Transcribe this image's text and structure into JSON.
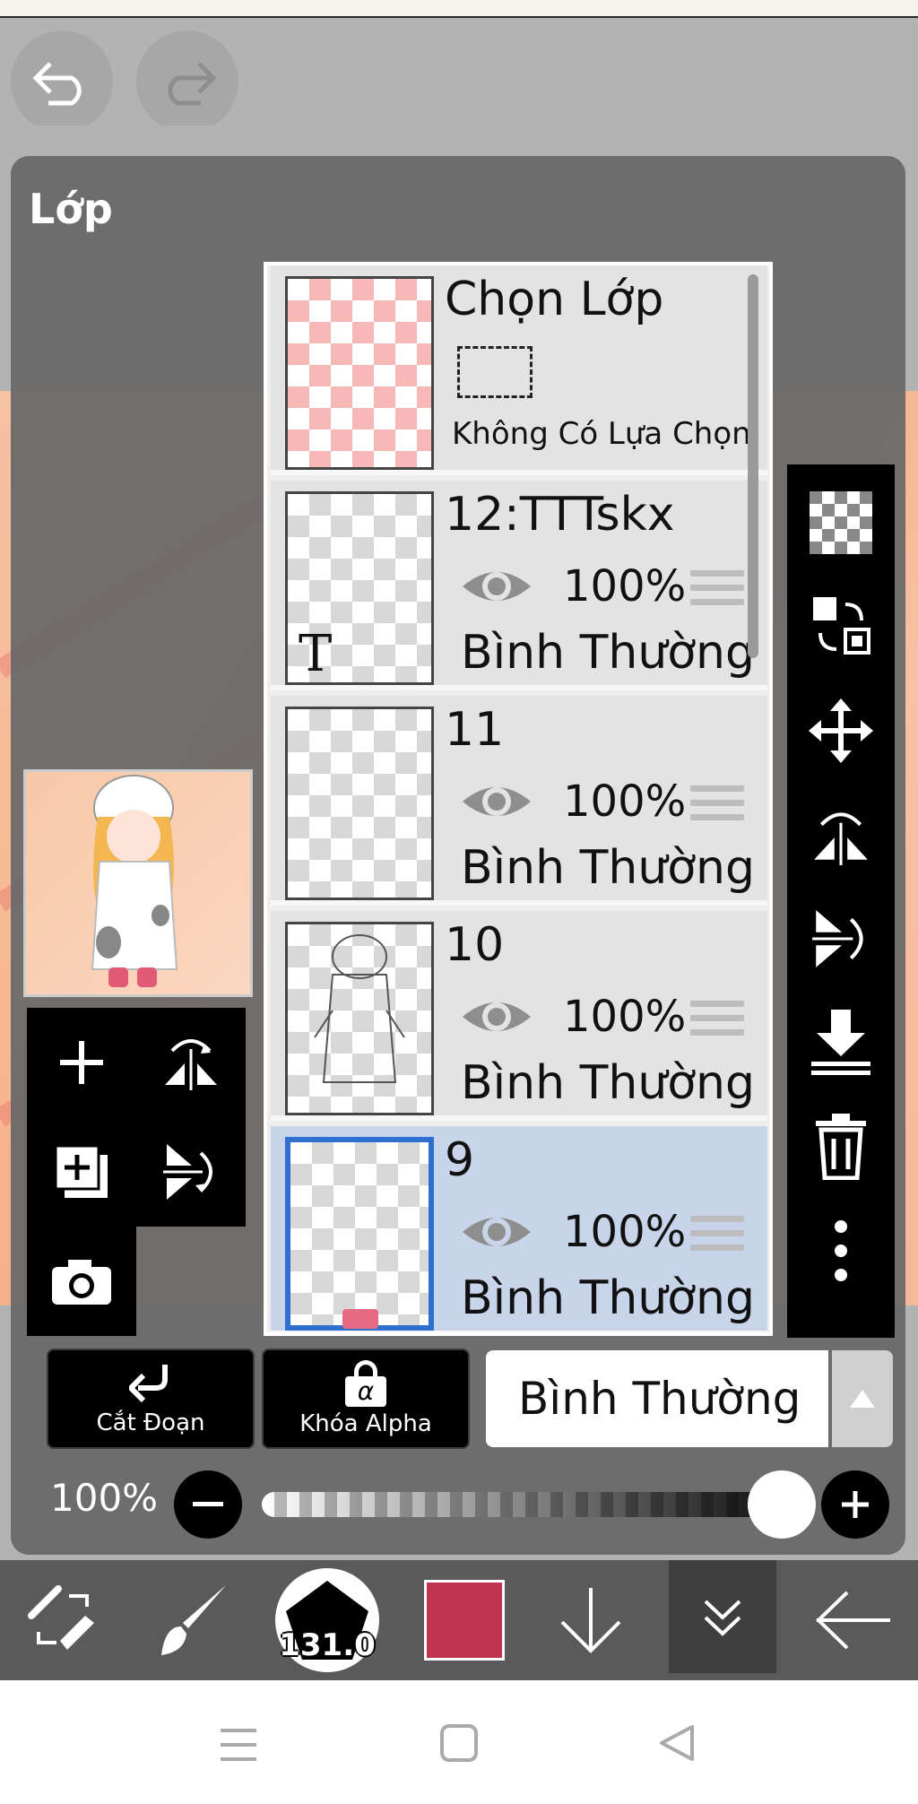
{
  "panel": {
    "title": "Lớp"
  },
  "selection_layer": {
    "name": "Chọn Lớp",
    "status": "Không Có Lựa Chọn"
  },
  "layers": [
    {
      "name": "12:TTTskx",
      "opacity": "100%",
      "blend": "Bình Thường",
      "type_marker": "T",
      "selected": false
    },
    {
      "name": "11",
      "opacity": "100%",
      "blend": "Bình Thường",
      "selected": false
    },
    {
      "name": "10",
      "opacity": "100%",
      "blend": "Bình Thường",
      "selected": false
    },
    {
      "name": "9",
      "opacity": "100%",
      "blend": "Bình Thường",
      "selected": true
    }
  ],
  "buttons": {
    "clipping": "Cắt Đoạn",
    "alpha_lock": "Khóa Alpha",
    "alpha_symbol": "α"
  },
  "blend_mode": {
    "value": "Bình Thường"
  },
  "opacity": {
    "label": "100%",
    "value": 1.0
  },
  "brush": {
    "size": "131.0"
  },
  "colors": {
    "primary": "#c0344e",
    "selection_highlight": "#2f6fd0",
    "panel": "#696969"
  }
}
